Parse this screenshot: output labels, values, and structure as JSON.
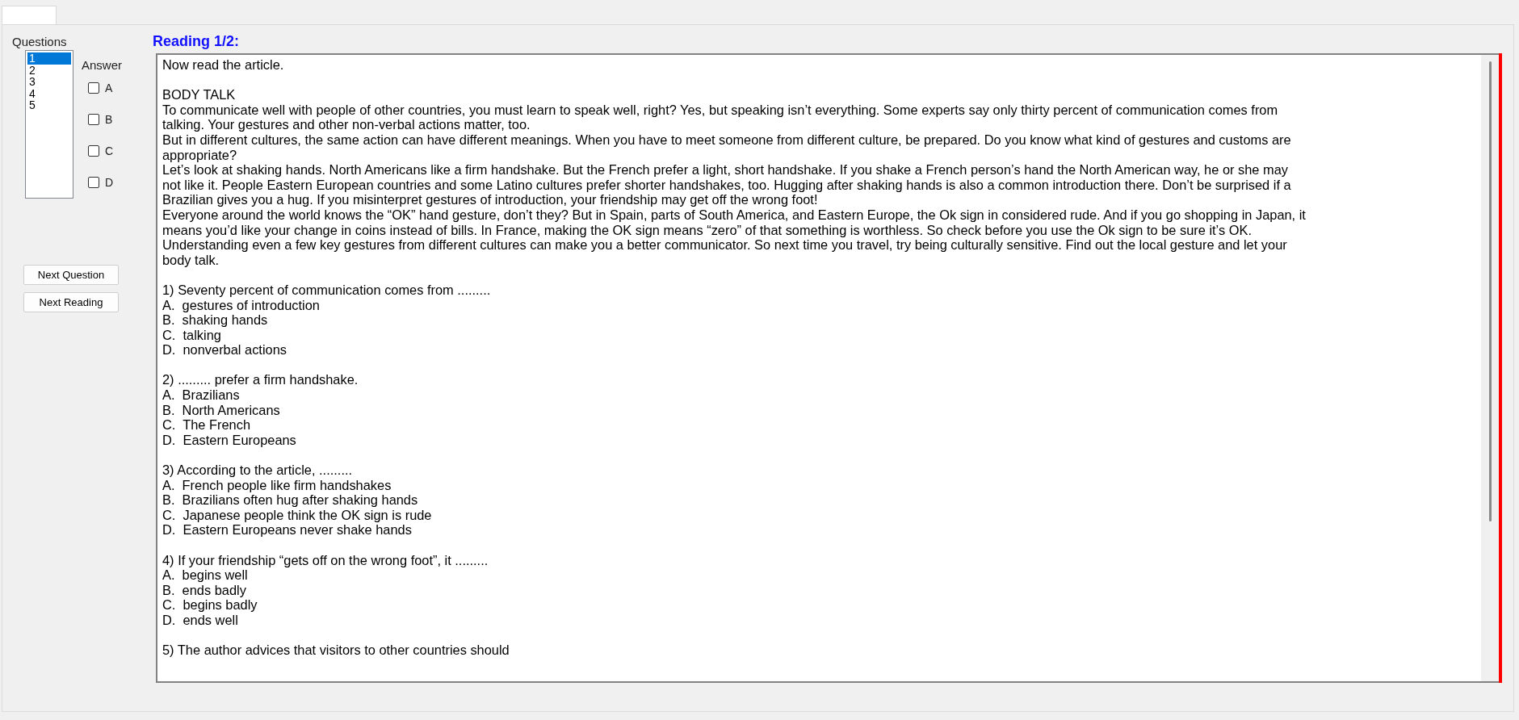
{
  "questions_panel": {
    "label": "Questions",
    "items": [
      {
        "label": "1",
        "selected": true
      },
      {
        "label": "2",
        "selected": false
      },
      {
        "label": "3",
        "selected": false
      },
      {
        "label": "4",
        "selected": false
      },
      {
        "label": "5",
        "selected": false
      }
    ]
  },
  "answer": {
    "label": "Answer",
    "options": [
      {
        "label": "A",
        "checked": false
      },
      {
        "label": "B",
        "checked": false
      },
      {
        "label": "C",
        "checked": false
      },
      {
        "label": "D",
        "checked": false
      }
    ]
  },
  "buttons": [
    "Next Question",
    "Next Reading"
  ],
  "reading": {
    "title": "Reading 1/2:",
    "instruction": "Now read the article.",
    "article_title": "BODY TALK",
    "paragraphs": [
      "To communicate well with people of other countries, you must learn to speak well, right? Yes, but speaking isn’t everything. Some experts say only thirty percent of communication comes from talking. Your gestures and other non-verbal actions matter, too.",
      "But in different cultures, the same action can have different meanings. When you have to meet someone from different culture, be prepared. Do you know what kind of gestures and customs are appropriate?",
      "Let’s look at shaking hands. North Americans like a firm handshake. But the French prefer a light, short handshake. If you shake a French person’s hand the North American way, he or she may not like it. People Eastern European countries and some Latino cultures prefer shorter handshakes, too. Hugging after shaking hands is also a common introduction there. Don’t be surprised if a Brazilian gives you a hug. If you misinterpret gestures of introduction, your friendship may get off the wrong foot!",
      "Everyone around the world knows the “OK” hand gesture, don’t they? But in Spain, parts of South America, and Eastern Europe, the Ok sign in considered rude. And if you go shopping in Japan, it means you’d like your change in coins instead of bills. In France, making the OK sign means “zero” of that something is worthless. So check before you use the Ok sign to be sure it’s OK.",
      "Understanding even a few key gestures from different cultures can make you a better communicator. So next time you travel, try being culturally sensitive. Find out the local gesture and let your body talk."
    ],
    "questions": [
      {
        "prompt": "1) Seventy percent of communication comes from .........",
        "options": [
          "A.  gestures of introduction",
          "B.  shaking hands",
          "C.  talking",
          "D.  nonverbal actions"
        ]
      },
      {
        "prompt": "2) ......... prefer a firm handshake.",
        "options": [
          "A.  Brazilians",
          "B.  North Americans",
          "C.  The French",
          "D.  Eastern Europeans"
        ]
      },
      {
        "prompt": "3) According to the article, .........",
        "options": [
          "A.  French people like firm handshakes",
          "B.  Brazilians often hug after shaking hands",
          "C.  Japanese people think the OK sign is rude",
          "D.  Eastern Europeans never shake hands"
        ]
      },
      {
        "prompt": "4) If your friendship “gets off on the wrong foot”, it .........",
        "options": [
          "A.  begins well",
          "B.  ends badly",
          "C.  begins badly",
          "D.  ends well"
        ]
      },
      {
        "prompt": "5) The author advices that visitors to other countries should"
      }
    ]
  }
}
